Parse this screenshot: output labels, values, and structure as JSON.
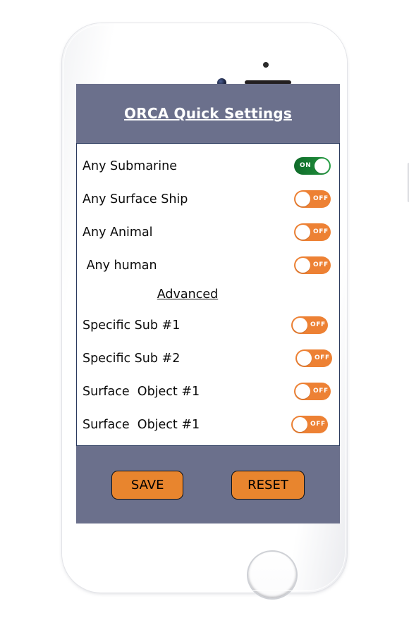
{
  "device": {
    "type": "white-smartphone-mockup",
    "hardware": {
      "earpiece": "earpiece-speaker",
      "front_camera": "front-camera",
      "proximity_sensor": "proximity-sensor",
      "home_button": "home-button",
      "mute_switch": "mute-switch",
      "volume_up": "volume-up-button",
      "volume_down": "volume-down-button",
      "power": "power-button"
    }
  },
  "colors": {
    "header_background": "#6b708c",
    "panel_background": "#ffffff",
    "panel_border": "#2b3a5e",
    "toggle_on": "#1b8436",
    "toggle_off": "#ed8134",
    "button_fill": "#e8852e",
    "button_text": "#000000",
    "title_text": "#ffffff",
    "label_text": "#0b0b0b",
    "page_background": "#ffffff"
  },
  "header": {
    "title": "ORCA Quick Settings"
  },
  "settings": {
    "basic_rows": [
      {
        "label": "Any Submarine",
        "state": "ON",
        "state_label": "ON"
      },
      {
        "label": "Any Surface Ship",
        "state": "OFF",
        "state_label": "OFF"
      },
      {
        "label": "Any Animal",
        "state": "OFF",
        "state_label": "OFF"
      },
      {
        "label": " Any human",
        "state": "OFF",
        "state_label": "OFF"
      }
    ],
    "advanced_heading": "Advanced",
    "advanced_rows": [
      {
        "label": "Specific Sub #1",
        "state": "OFF",
        "state_label": "OFF"
      },
      {
        "label": "Specific Sub #2",
        "state": "OFF",
        "state_label": "OFF"
      },
      {
        "label": "Surface  Object #1",
        "state": "OFF",
        "state_label": "OFF"
      },
      {
        "label": "Surface  Object #1",
        "state": "OFF",
        "state_label": "OFF"
      }
    ]
  },
  "footer": {
    "save_label": "SAVE",
    "reset_label": "RESET"
  }
}
